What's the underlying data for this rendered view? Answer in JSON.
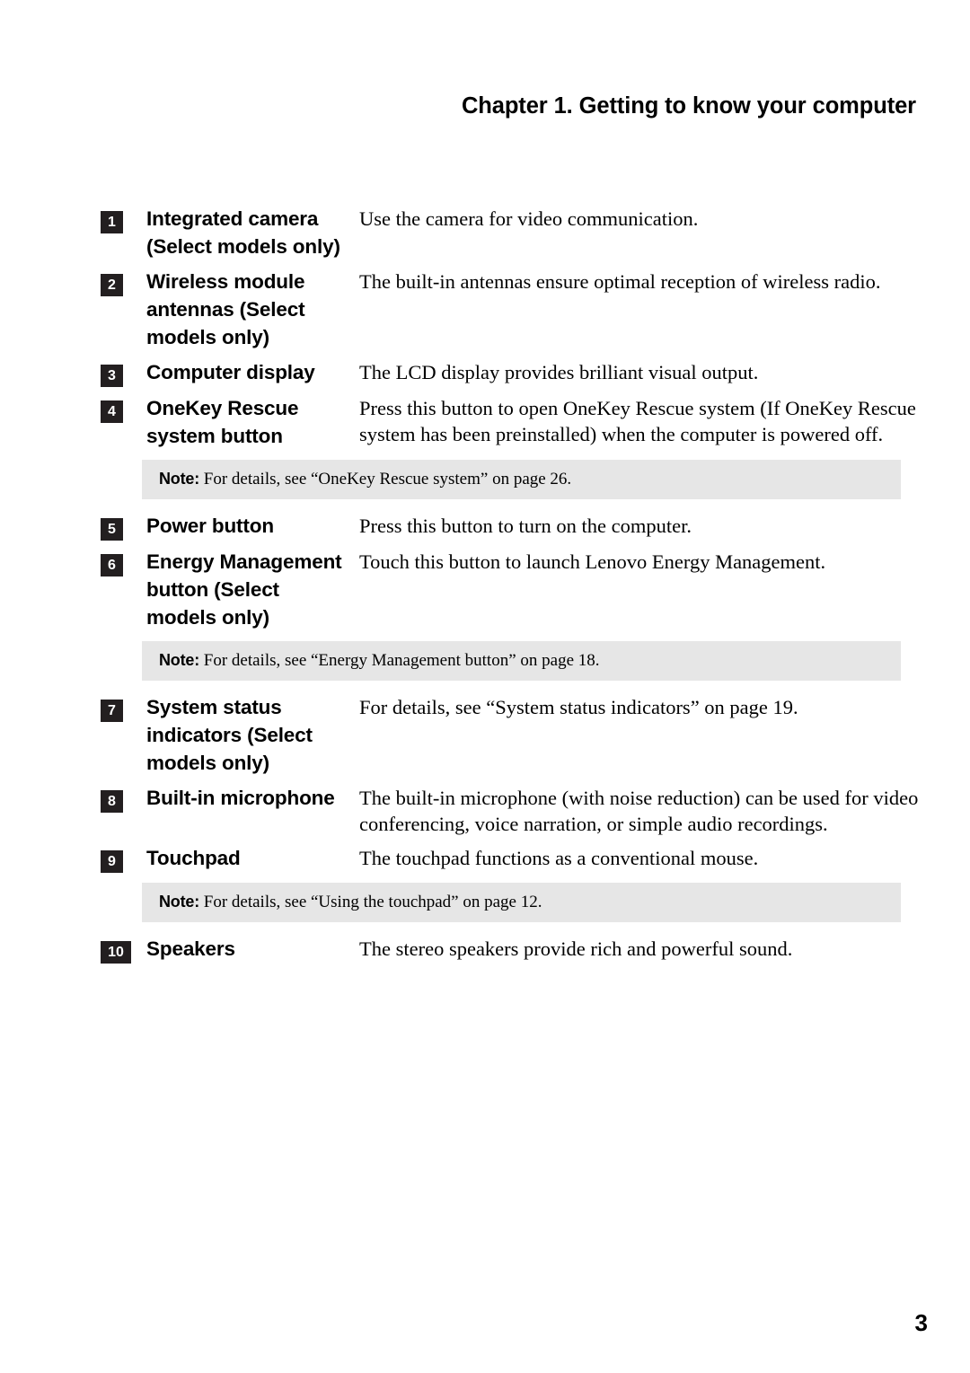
{
  "header": {
    "title": "Chapter 1. Getting to know your computer"
  },
  "footer": {
    "page_number": "3"
  },
  "note_label": "Note:",
  "rows": [
    {
      "kind": "feature",
      "number": "1",
      "label": "Integrated camera (Select models only)",
      "description": "Use the camera for video communication."
    },
    {
      "kind": "feature",
      "number": "2",
      "label": "Wireless module antennas (Select models only)",
      "description": "The built-in antennas ensure optimal reception of wireless radio."
    },
    {
      "kind": "feature",
      "number": "3",
      "label": "Computer display",
      "description": "The LCD display provides brilliant visual output."
    },
    {
      "kind": "feature",
      "number": "4",
      "label": "OneKey Rescue system button",
      "description": "Press this button to open OneKey Rescue system (If OneKey Rescue system has been preinstalled) when the computer is powered off."
    },
    {
      "kind": "note",
      "text": "For details, see “OneKey Rescue system” on page 26."
    },
    {
      "kind": "feature",
      "number": "5",
      "label": "Power button",
      "description": "Press this button to turn on the computer."
    },
    {
      "kind": "feature",
      "number": "6",
      "label": "Energy Management button (Select models only)",
      "description": "Touch this button to launch Lenovo Energy Management."
    },
    {
      "kind": "note",
      "text": "For details, see “Energy Management button” on page 18."
    },
    {
      "kind": "feature",
      "number": "7",
      "label": "System status indicators (Select models only)",
      "description": "For details, see “System status indicators” on page 19."
    },
    {
      "kind": "feature",
      "number": "8",
      "label": "Built-in microphone",
      "description": "The built-in microphone (with noise reduction) can be used for video conferencing, voice narration, or simple audio recordings."
    },
    {
      "kind": "feature",
      "number": "9",
      "label": "Touchpad",
      "description": "The touchpad functions as a conventional mouse."
    },
    {
      "kind": "note",
      "text": "For details, see “Using the touchpad” on page 12."
    },
    {
      "kind": "feature",
      "number": "10",
      "label": "Speakers",
      "description": "The stereo speakers provide rich and powerful sound."
    }
  ],
  "colors": {
    "badge_background": "#231f20",
    "badge_text": "#ffffff",
    "note_background": "#e6e6e6",
    "text": "#000000",
    "page_background": "#ffffff"
  }
}
